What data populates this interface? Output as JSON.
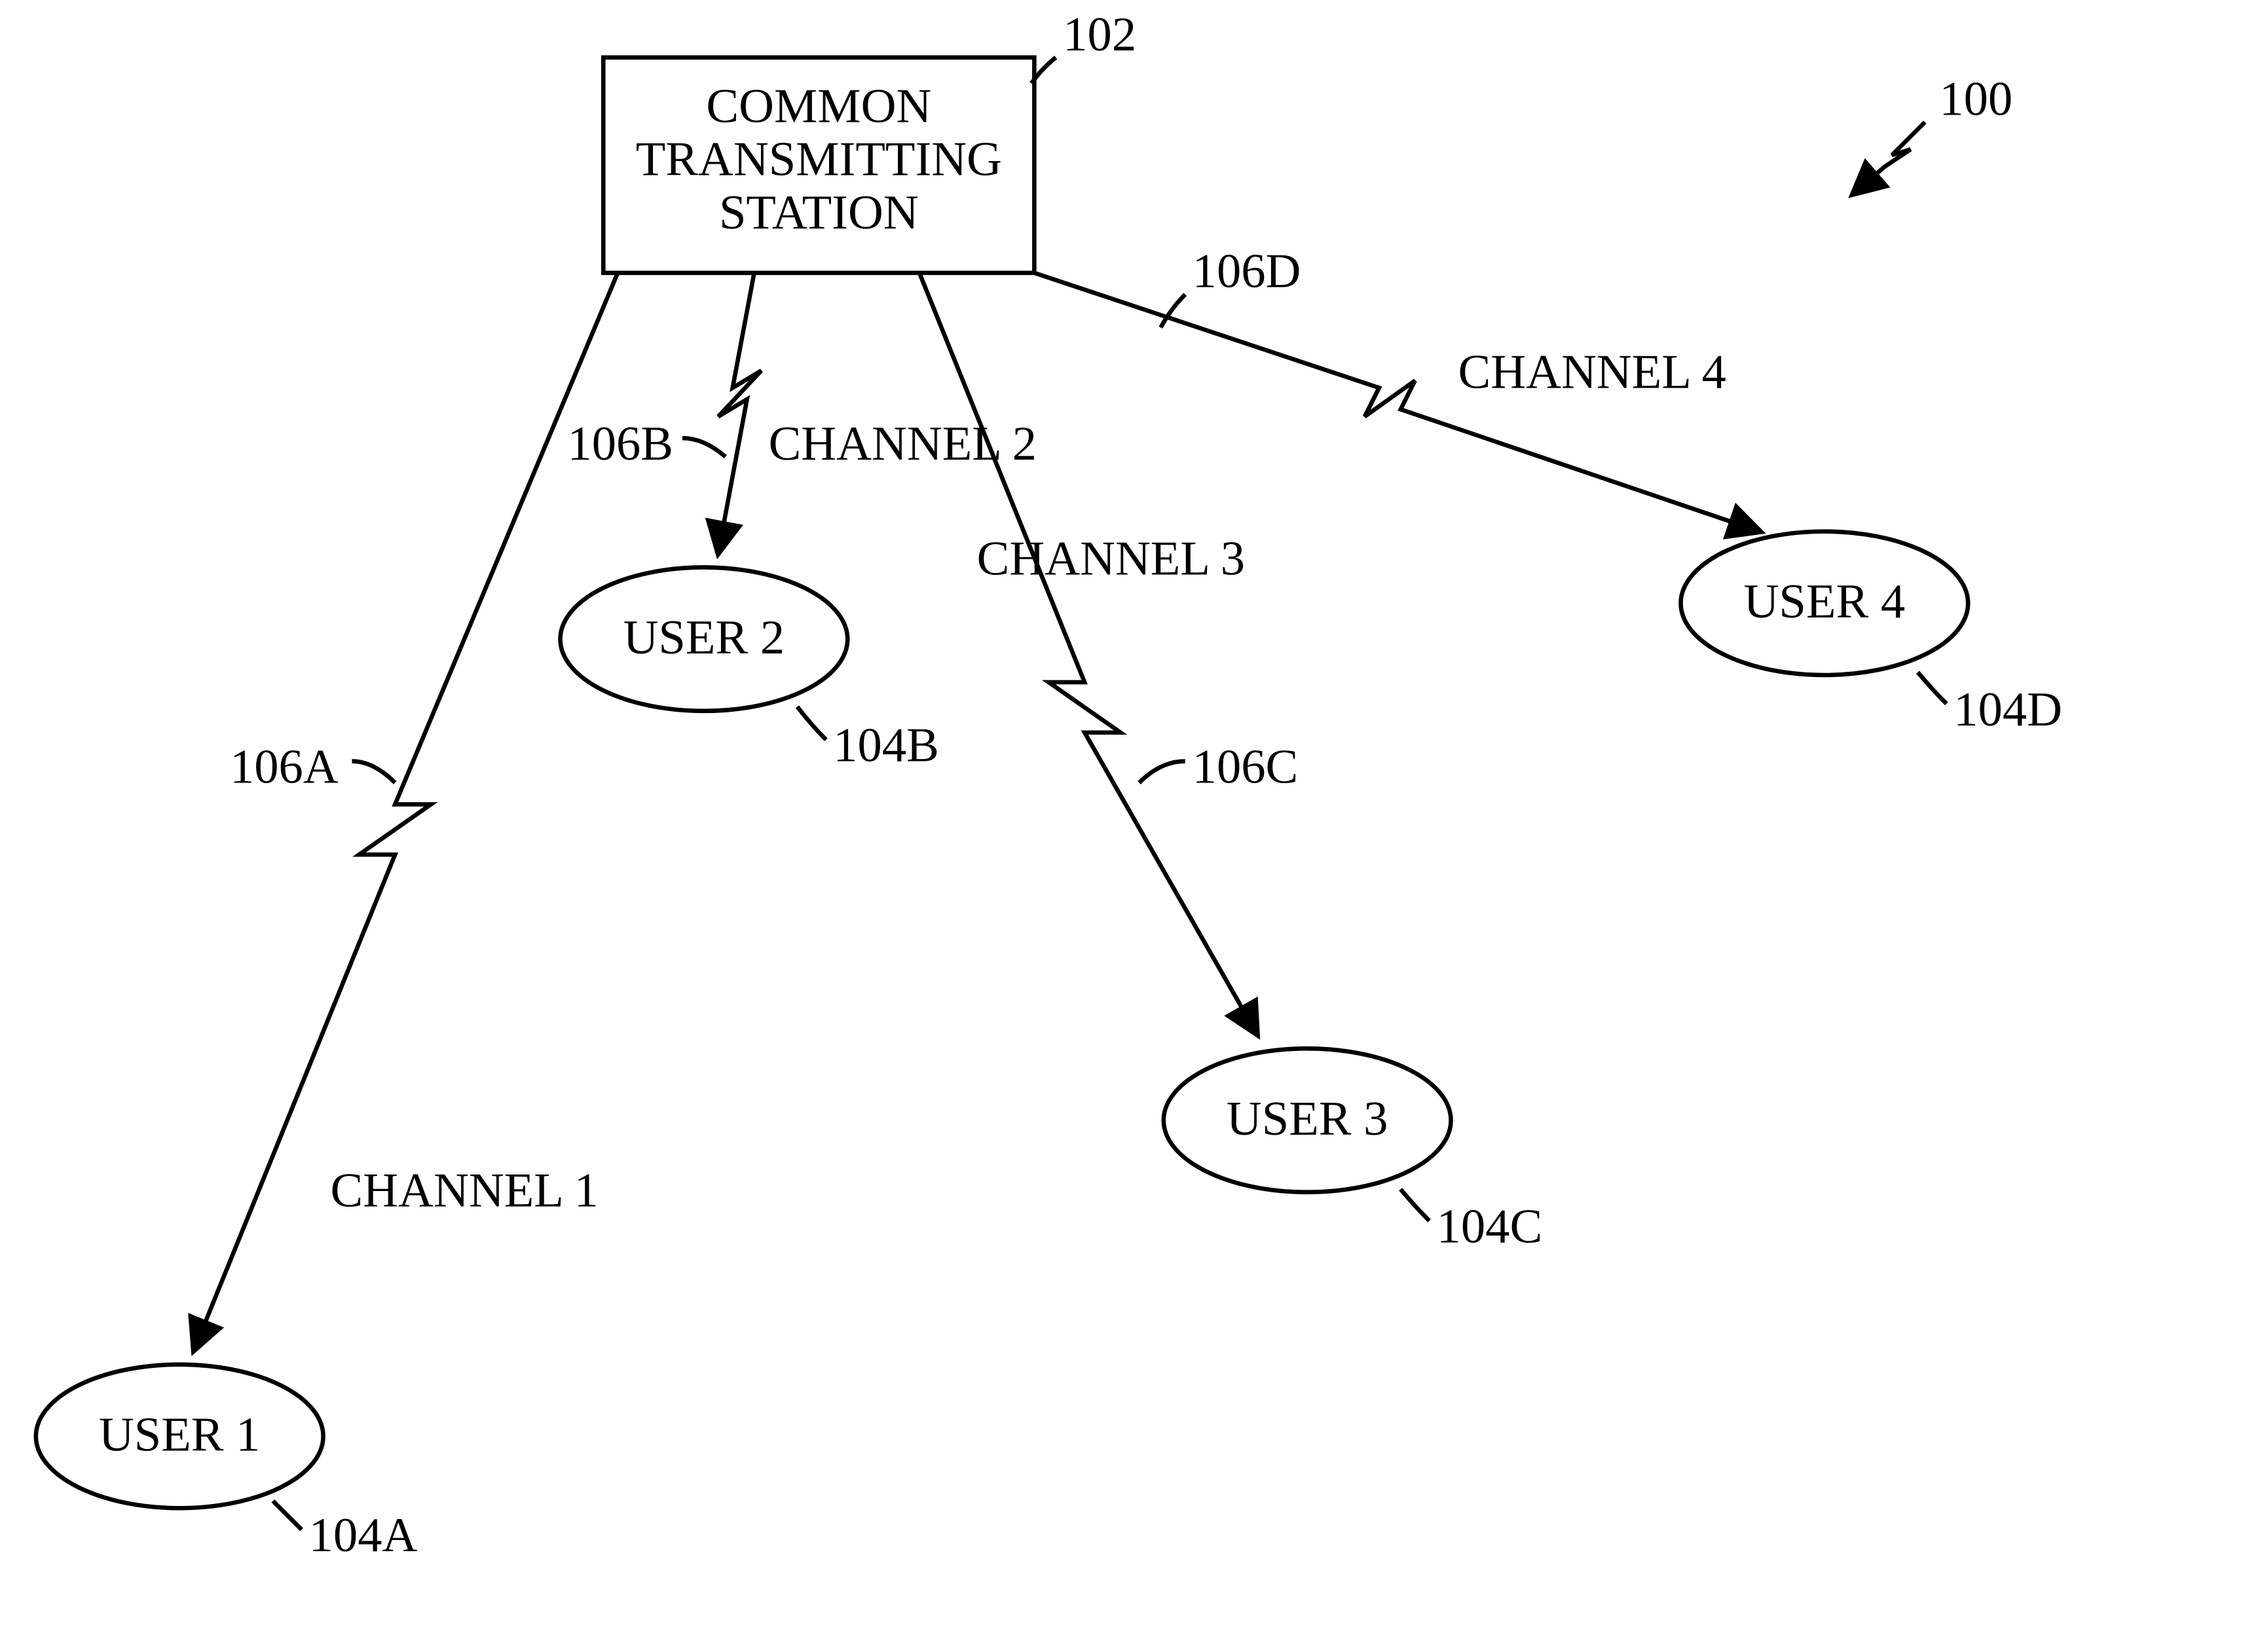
{
  "figure_ref": "100",
  "station": {
    "ref": "102",
    "line1": "COMMON",
    "line2": "TRANSMITTING",
    "line3": "STATION"
  },
  "users": [
    {
      "id": "A",
      "label": "USER 1",
      "ref": "104A"
    },
    {
      "id": "B",
      "label": "USER 2",
      "ref": "104B"
    },
    {
      "id": "C",
      "label": "USER 3",
      "ref": "104C"
    },
    {
      "id": "D",
      "label": "USER 4",
      "ref": "104D"
    }
  ],
  "channels": [
    {
      "id": "A",
      "label": "CHANNEL 1",
      "ref": "106A"
    },
    {
      "id": "B",
      "label": "CHANNEL 2",
      "ref": "106B"
    },
    {
      "id": "C",
      "label": "CHANNEL 3",
      "ref": "106C"
    },
    {
      "id": "D",
      "label": "CHANNEL 4",
      "ref": "106D"
    }
  ]
}
